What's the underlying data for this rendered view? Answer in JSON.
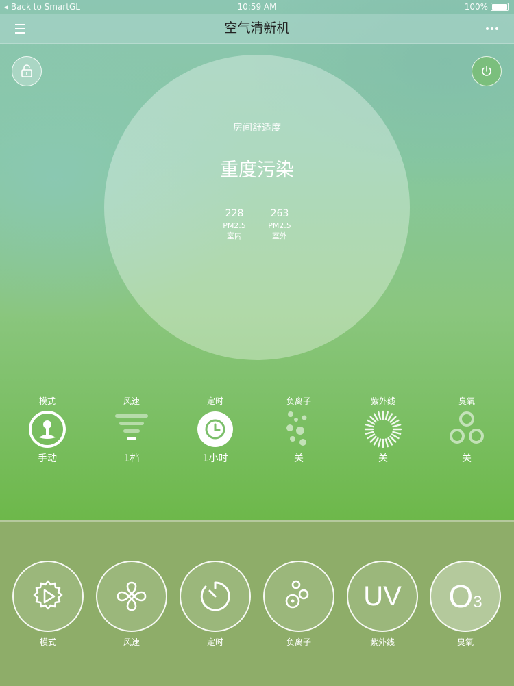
{
  "statusbar": {
    "back": "◂ Back to SmartGL",
    "time": "10:59 AM",
    "battery": "100%"
  },
  "navbar": {
    "title": "空气清新机"
  },
  "main": {
    "comfort_label": "房间舒适度",
    "air_status": "重度污染",
    "indoor": {
      "value": "228",
      "unit": "PM2.5",
      "location": "室内"
    },
    "outdoor": {
      "value": "263",
      "unit": "PM2.5",
      "location": "室外"
    }
  },
  "status_items": [
    {
      "label": "模式",
      "value": "手动",
      "icon": "joystick-icon"
    },
    {
      "label": "风速",
      "value": "1档",
      "icon": "fan-speed-icon"
    },
    {
      "label": "定时",
      "value": "1小时",
      "icon": "clock-icon"
    },
    {
      "label": "负离子",
      "value": "关",
      "icon": "ion-bubbles-icon"
    },
    {
      "label": "紫外线",
      "value": "关",
      "icon": "uv-rays-icon"
    },
    {
      "label": "臭氧",
      "value": "关",
      "icon": "ozone-rings-icon"
    }
  ],
  "controls": [
    {
      "label": "模式",
      "icon": "mode-gear-icon"
    },
    {
      "label": "风速",
      "icon": "fan-icon"
    },
    {
      "label": "定时",
      "icon": "timer-icon"
    },
    {
      "label": "负离子",
      "icon": "ion-icon"
    },
    {
      "label": "紫外线",
      "icon_text": "UV"
    },
    {
      "label": "臭氧",
      "icon_text": "O",
      "icon_sub": "3"
    }
  ],
  "colors": {
    "accent_green": "#6db84a",
    "bottom_panel": "#8ead69"
  }
}
